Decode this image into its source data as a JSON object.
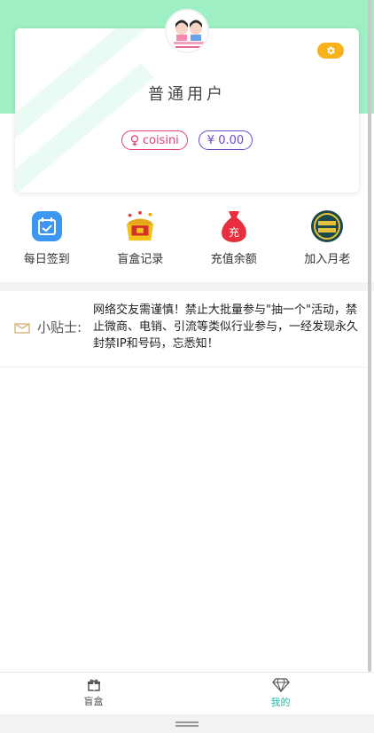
{
  "profile": {
    "level": "普通用户",
    "username": "coisini",
    "balance": "¥ 0.00",
    "gender_icon": "female-icon",
    "settings_icon": "gear-icon"
  },
  "menu": [
    {
      "label": "每日签到",
      "icon": "calendar-check-icon"
    },
    {
      "label": "盲盒记录",
      "icon": "treasure-box-icon"
    },
    {
      "label": "充值余额",
      "icon": "money-bag-icon"
    },
    {
      "label": "加入月老",
      "icon": "matchmaker-badge-icon"
    }
  ],
  "tips": {
    "title": "小贴士:",
    "text": "网络交友需谨慎！禁止大批量参与\"抽一个\"活动，禁止微商、电销、引流等类似行业参与，一经发现永久封禁IP和号码，忘悉知！"
  },
  "tabbar": [
    {
      "label": "盲盒",
      "icon": "gift-icon",
      "active": false
    },
    {
      "label": "我的",
      "icon": "diamond-icon",
      "active": true
    }
  ],
  "colors": {
    "accent": "#9ef0c4",
    "active_tab": "#2bb5a2",
    "gear_bg": "#f8b21a",
    "name_tag": "#e23f74",
    "balance_tag": "#6b49c8"
  }
}
